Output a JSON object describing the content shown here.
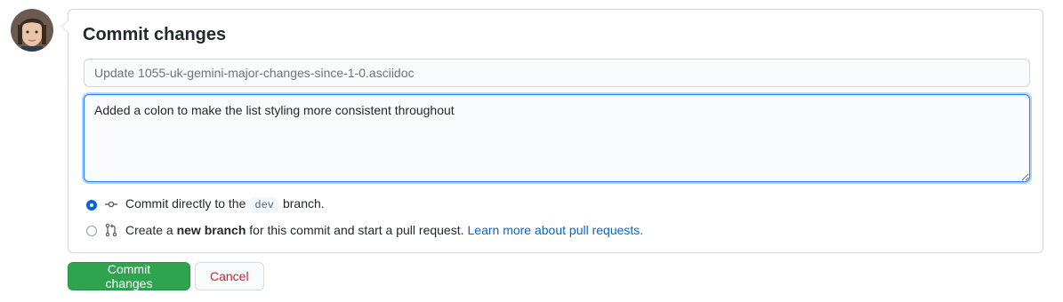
{
  "form": {
    "title": "Commit changes",
    "summary_placeholder": "Update 1055-uk-gemini-major-changes-since-1-0.asciidoc",
    "summary_value": "",
    "description_value": "Added a colon to make the list styling more consistent throughout"
  },
  "options": {
    "direct": {
      "selected": true,
      "prefix": "Commit directly to the",
      "branch": "dev",
      "suffix": "branch.",
      "icon": "git-commit-icon"
    },
    "new_branch": {
      "selected": false,
      "prefix": "Create a",
      "bold": "new branch",
      "suffix": "for this commit and start a pull request.",
      "link": "Learn more about pull requests.",
      "icon": "git-pull-request-icon"
    }
  },
  "buttons": {
    "commit_label": "Commit changes",
    "cancel_label": "Cancel"
  },
  "colors": {
    "primary_button": "#2ea44f",
    "danger_text": "#cb2431",
    "link": "#0366d6",
    "focus_border": "#2188ff"
  }
}
